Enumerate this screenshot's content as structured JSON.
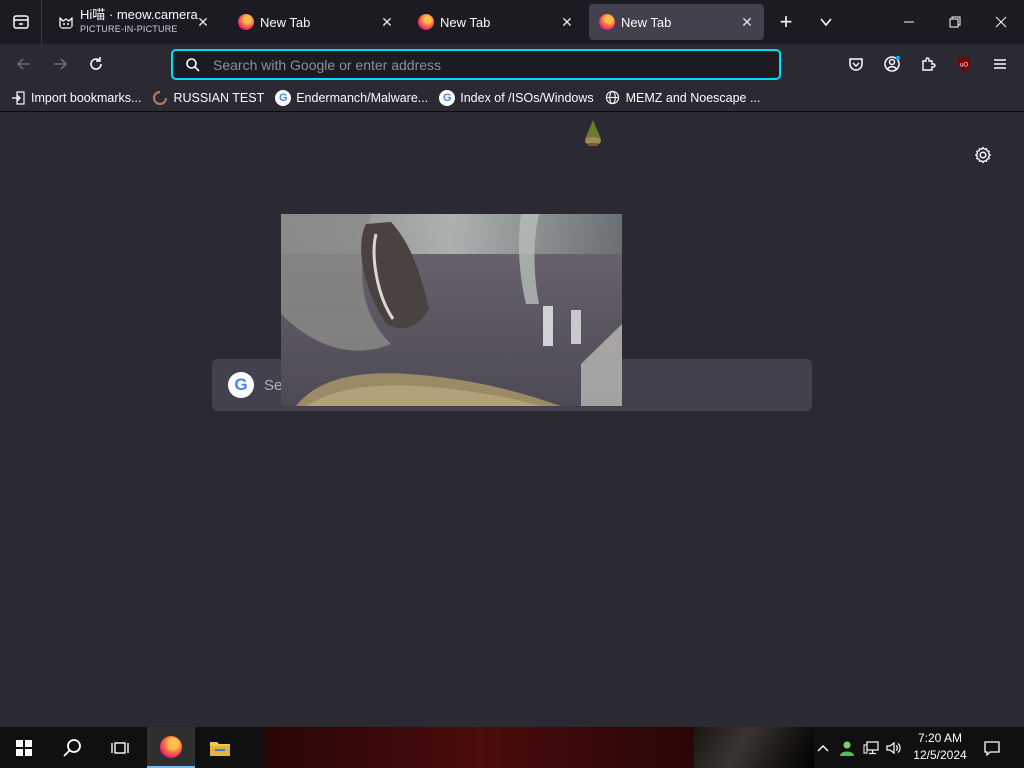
{
  "browser": {
    "tabs": [
      {
        "title": "Hi喵 · meow.camera",
        "subtitle": "PICTURE-IN-PICTURE",
        "active": false
      },
      {
        "title": "New Tab",
        "active": false
      },
      {
        "title": "New Tab",
        "active": false
      },
      {
        "title": "New Tab",
        "active": true
      }
    ],
    "new_tab_label": "+",
    "close_glyph": "✕"
  },
  "navbar": {
    "url_placeholder": "Search with Google or enter address"
  },
  "bookmarks": [
    {
      "label": "Import bookmarks...",
      "icon": "import-icon"
    },
    {
      "label": "RUSSIAN TEST",
      "icon": "site-icon"
    },
    {
      "label": "Endermanch/Malware...",
      "icon": "google-icon"
    },
    {
      "label": "Index of /ISOs/Windows",
      "icon": "google-icon"
    },
    {
      "label": "MEMZ and Noescape ...",
      "icon": "globe-icon"
    }
  ],
  "newtab": {
    "search_placeholder": "Se",
    "google_glyph": "G"
  },
  "taskbar": {
    "time": "7:20 AM",
    "date": "12/5/2024"
  },
  "colors": {
    "accent": "#00ddff",
    "background": "#2b2a33",
    "tabstrip": "#1c1b22",
    "active_tab": "#42414d"
  }
}
